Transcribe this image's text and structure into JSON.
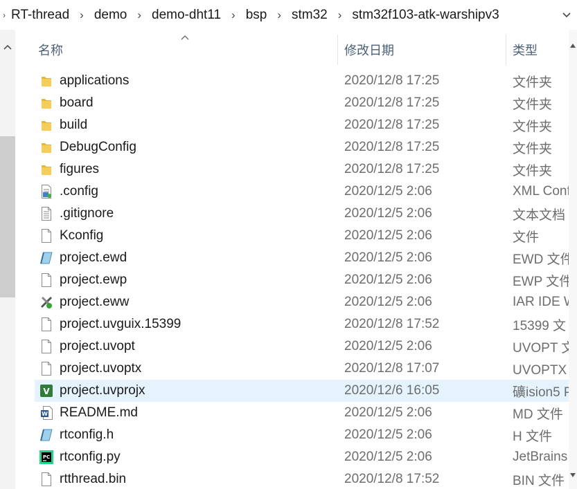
{
  "breadcrumb": {
    "segments": [
      "RT-thread",
      "demo",
      "demo-dht11",
      "bsp",
      "stm32",
      "stm32f103-atk-warshipv3"
    ]
  },
  "columns": {
    "name": "名称",
    "date": "修改日期",
    "type": "类型"
  },
  "files": [
    {
      "name": "applications",
      "date": "2020/12/8 17:25",
      "type": "文件夹",
      "icon": "folder-icon"
    },
    {
      "name": "board",
      "date": "2020/12/8 17:25",
      "type": "文件夹",
      "icon": "folder-icon"
    },
    {
      "name": "build",
      "date": "2020/12/8 17:25",
      "type": "文件夹",
      "icon": "folder-icon"
    },
    {
      "name": "DebugConfig",
      "date": "2020/12/8 17:25",
      "type": "文件夹",
      "icon": "folder-icon"
    },
    {
      "name": "figures",
      "date": "2020/12/8 17:25",
      "type": "文件夹",
      "icon": "folder-icon"
    },
    {
      "name": ".config",
      "date": "2020/12/5 2:06",
      "type": "XML Conf",
      "icon": "xml-file-icon"
    },
    {
      "name": ".gitignore",
      "date": "2020/12/5 2:06",
      "type": "文本文档",
      "icon": "text-file-icon"
    },
    {
      "name": "Kconfig",
      "date": "2020/12/5 2:06",
      "type": "文件",
      "icon": "blank-file-icon"
    },
    {
      "name": "project.ewd",
      "date": "2020/12/5 2:06",
      "type": "EWD 文件",
      "icon": "generic-app-file-icon"
    },
    {
      "name": "project.ewp",
      "date": "2020/12/5 2:06",
      "type": "EWP 文件",
      "icon": "blank-file-icon"
    },
    {
      "name": "project.eww",
      "date": "2020/12/5 2:06",
      "type": "IAR IDE W",
      "icon": "iar-workspace-icon"
    },
    {
      "name": "project.uvguix.15399",
      "date": "2020/12/8 17:52",
      "type": "15399 文",
      "icon": "blank-file-icon"
    },
    {
      "name": "project.uvopt",
      "date": "2020/12/5 2:06",
      "type": "UVOPT 文",
      "icon": "blank-file-icon"
    },
    {
      "name": "project.uvoptx",
      "date": "2020/12/8 17:07",
      "type": "UVOPTX 文",
      "icon": "blank-file-icon"
    },
    {
      "name": "project.uvprojx",
      "date": "2020/12/6 16:05",
      "type": "礦ision5 P",
      "icon": "keil-project-icon",
      "selected": true
    },
    {
      "name": "README.md",
      "date": "2020/12/5 2:06",
      "type": "MD 文件",
      "icon": "word-document-icon"
    },
    {
      "name": "rtconfig.h",
      "date": "2020/12/5 2:06",
      "type": "H 文件",
      "icon": "generic-app-file-icon"
    },
    {
      "name": "rtconfig.py",
      "date": "2020/12/5 2:06",
      "type": "JetBrains",
      "icon": "pycharm-file-icon"
    },
    {
      "name": "rtthread.bin",
      "date": "2020/12/8 17:52",
      "type": "BIN 文件",
      "icon": "blank-file-icon"
    }
  ]
}
